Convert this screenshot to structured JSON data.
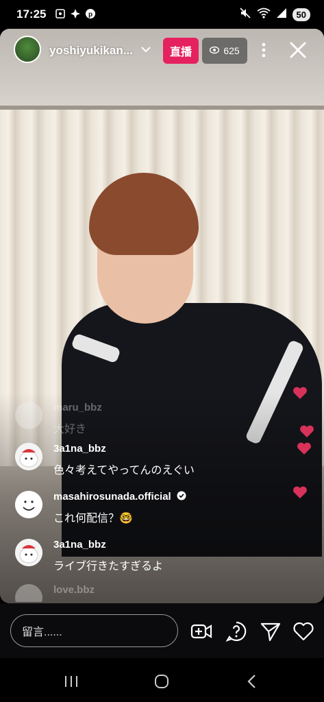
{
  "status_bar": {
    "time": "17:25",
    "battery": "50"
  },
  "live": {
    "username": "yoshiyukikan...",
    "live_label": "直播",
    "viewer_count": "625"
  },
  "comments": [
    {
      "user": "maru_bbz",
      "text": "大好き",
      "faded": true
    },
    {
      "user": "3a1na_bbz",
      "text": "色々考えてやってんのえぐい",
      "faded": false
    },
    {
      "user": "masahirosunada.official",
      "text": "これ何配信？🤓",
      "faded": false,
      "verified": true
    },
    {
      "user": "3a1na_bbz",
      "text": "ライブ行きたすぎるよ",
      "faded": false
    },
    {
      "user": "love.bbz",
      "text": "",
      "faded": true
    }
  ],
  "bottom_bar": {
    "comment_placeholder": "留言......"
  },
  "colors": {
    "live_badge": "#e6215f",
    "heart": "#d8325a"
  }
}
